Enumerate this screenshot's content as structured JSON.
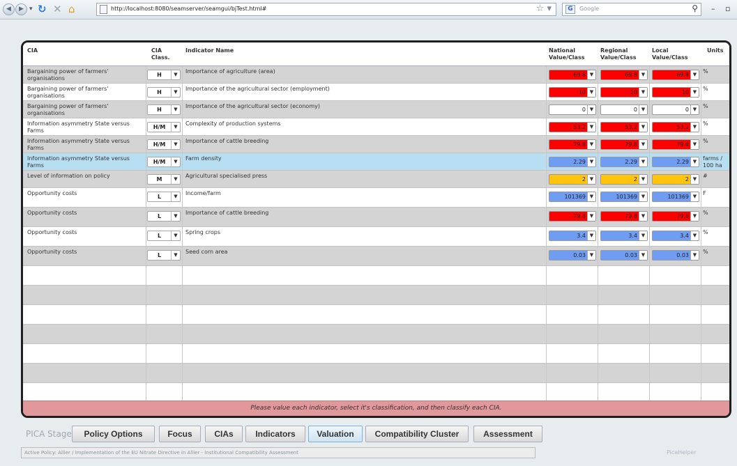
{
  "browser": {
    "url": "http://localhost:8080/seamserver/seamgui/bjTest.html#",
    "search_placeholder": "Google"
  },
  "table": {
    "headers": {
      "cia": "CIA",
      "cia_class": "CIA Class.",
      "indicator": "Indicator Name",
      "national": "National Value/Class",
      "regional": "Regional Value/Class",
      "local": "Local Value/Class",
      "units": "Units"
    },
    "rows": [
      {
        "cia": "Bargaining power of farmers' organisations",
        "cls": "H",
        "indicator": "Importance of agriculture (area)",
        "national": "69.8",
        "regional": "69.8",
        "local": "69.8",
        "color": "#ff0000",
        "units": "%"
      },
      {
        "cia": "Bargaining power of farmers' organisations",
        "cls": "H",
        "indicator": "Importance of the agricultural sector (employment)",
        "national": "10",
        "regional": "10",
        "local": "10",
        "color": "#ff0000",
        "units": "%"
      },
      {
        "cia": "Bargaining power of farmers' organisations",
        "cls": "H",
        "indicator": "Importance of the agricultural sector (economy)",
        "national": "0",
        "regional": "0",
        "local": "0",
        "color": "#ffffff",
        "units": "%"
      },
      {
        "cia": "Information asymmetry State versus Farms",
        "cls": "H/M",
        "indicator": "Complexity of production systems",
        "national": "53.2",
        "regional": "53.2",
        "local": "53.2",
        "color": "#ff0000",
        "units": "%"
      },
      {
        "cia": "Information asymmetry State versus Farms",
        "cls": "H/M",
        "indicator": "Importance of cattle breeding",
        "national": "79.8",
        "regional": "79.8",
        "local": "79.8",
        "color": "#ff0000",
        "units": "%"
      },
      {
        "cia": "Information asymmetry State versus Farms",
        "cls": "H/M",
        "indicator": "Farm density",
        "national": "2.29",
        "regional": "2.29",
        "local": "2.29",
        "color": "#6f9df3",
        "units": "farms / 100 ha",
        "selected": true
      },
      {
        "cia": "Level of information on policy",
        "cls": "M",
        "indicator": "Agricultural specialised press",
        "national": "2",
        "regional": "2",
        "local": "2",
        "color": "#ffc40c",
        "units": "#"
      },
      {
        "cia": "Opportunity costs",
        "cls": "L",
        "indicator": "Income/farm",
        "national": "101369",
        "regional": "101369",
        "local": "101369",
        "color": "#6f9df3",
        "units": "F"
      },
      {
        "cia": "Opportunity costs",
        "cls": "L",
        "indicator": "Importance of cattle breeding",
        "national": "79.8",
        "regional": "79.8",
        "local": "79.8",
        "color": "#ff0000",
        "units": "%"
      },
      {
        "cia": "Opportunity costs",
        "cls": "L",
        "indicator": "Spring crops",
        "national": "3.4",
        "regional": "3.4",
        "local": "3.4",
        "color": "#6f9df3",
        "units": "%"
      },
      {
        "cia": "Opportunity costs",
        "cls": "L",
        "indicator": "Seed corn area",
        "national": "0.03",
        "regional": "0.03",
        "local": "0.03",
        "color": "#6f9df3",
        "units": "%"
      }
    ],
    "message": "Please value each indicator, select it's classification, and then classify each CIA."
  },
  "stages": {
    "label": "PICA Stages:",
    "items": [
      "Policy Options",
      "Focus",
      "CIAs",
      "Indicators",
      "Valuation",
      "Compatibility Cluster",
      "Assessment"
    ],
    "active": "Valuation"
  },
  "status": {
    "text": "Active Policy: Allier / Implementation of the EU Nitrate Directive in Allier - Institutional Compatibility Assessment",
    "helper": "PicaHelper"
  }
}
